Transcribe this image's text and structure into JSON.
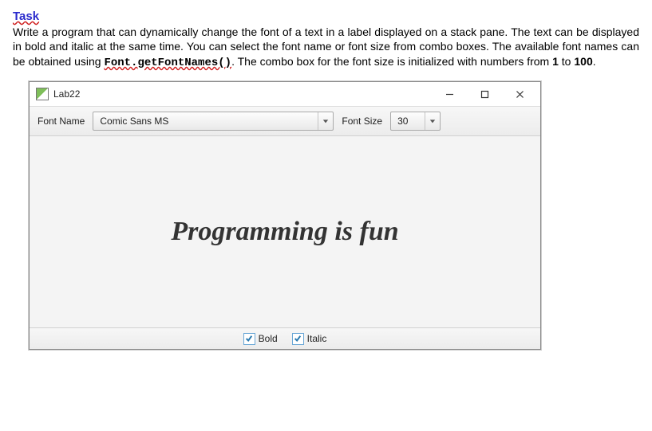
{
  "task": {
    "heading": "Task",
    "para_pre": "Write a program that can dynamically change the font of a text in a label displayed on a stack pane. The text can be displayed in bold and italic at the same time. You can select the font name or font size from combo boxes. The available font names can be obtained using ",
    "code": "Font.getFontNames()",
    "para_mid": ". The combo box for the font size is initialized with numbers from ",
    "one": "1",
    "to": " to ",
    "hundred": "100",
    "period": "."
  },
  "window": {
    "title": "Lab22",
    "toolbar": {
      "font_name_label": "Font Name",
      "font_name_value": "Comic Sans MS",
      "font_size_label": "Font Size",
      "font_size_value": "30"
    },
    "display_text": "Programming is fun",
    "checks": {
      "bold_label": "Bold",
      "italic_label": "Italic"
    }
  }
}
